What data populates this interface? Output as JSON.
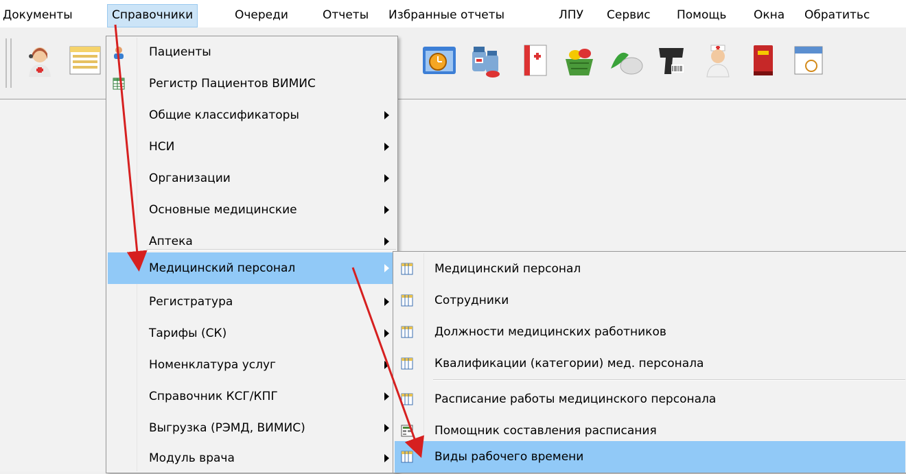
{
  "menubar": {
    "items": [
      {
        "label": "Документы"
      },
      {
        "label": "Справочники"
      },
      {
        "label": "Очереди"
      },
      {
        "label": "Отчеты"
      },
      {
        "label": "Избранные отчеты"
      },
      {
        "label": "ЛПУ"
      },
      {
        "label": "Сервис"
      },
      {
        "label": "Помощь"
      },
      {
        "label": "Окна"
      },
      {
        "label": "Обратитьс"
      }
    ]
  },
  "toolbar": {
    "buttons": [
      {
        "icon": "doctor-headset-icon"
      },
      {
        "icon": "document-list-icon"
      },
      {
        "icon": "schedule-clock-icon"
      },
      {
        "icon": "medicine-bottles-icon"
      },
      {
        "icon": "first-aid-book-icon"
      },
      {
        "icon": "pill-basket-icon"
      },
      {
        "icon": "pills-icon"
      },
      {
        "icon": "barcode-scanner-icon"
      },
      {
        "icon": "nurse-icon"
      },
      {
        "icon": "red-book-icon"
      },
      {
        "icon": "calendar-icon"
      }
    ]
  },
  "main_menu": {
    "items": [
      {
        "label": "Пациенты",
        "icon": "patient-icon"
      },
      {
        "label": "Регистр Пациентов ВИМИС",
        "icon": "register-grid-icon"
      },
      {
        "label": "Общие классификаторы"
      },
      {
        "label": "НСИ"
      },
      {
        "label": "Организации"
      },
      {
        "label": "Основные медицинские"
      },
      {
        "label": "Аптека"
      },
      {
        "label": "Медицинский персонал"
      },
      {
        "label": "Регистратура"
      },
      {
        "label": "Тарифы (СК)"
      },
      {
        "label": "Номенклатура услуг"
      },
      {
        "label": "Справочник КСГ/КПГ"
      },
      {
        "label": "Выгрузка (РЭМД, ВИМИС)"
      },
      {
        "label": "Модуль врача"
      }
    ]
  },
  "submenu": {
    "items": [
      {
        "label": "Медицинский персонал",
        "icon": "table-icon"
      },
      {
        "label": "Сотрудники",
        "icon": "table-icon"
      },
      {
        "label": "Должности медицинских работников",
        "icon": "table-icon"
      },
      {
        "label": "Квалификации (категории) мед. персонала",
        "icon": "table-icon"
      },
      {
        "label": "Расписание работы медицинского персонала",
        "icon": "table-icon"
      },
      {
        "label": "Помощник составления расписания",
        "icon": "schedule-wizard-icon"
      },
      {
        "label": "Виды рабочего времени",
        "icon": "table-icon"
      }
    ]
  },
  "colors": {
    "highlight": "#91c9f7",
    "menubar_active": "#cce4f7",
    "annotation_arrow": "#d62020"
  }
}
